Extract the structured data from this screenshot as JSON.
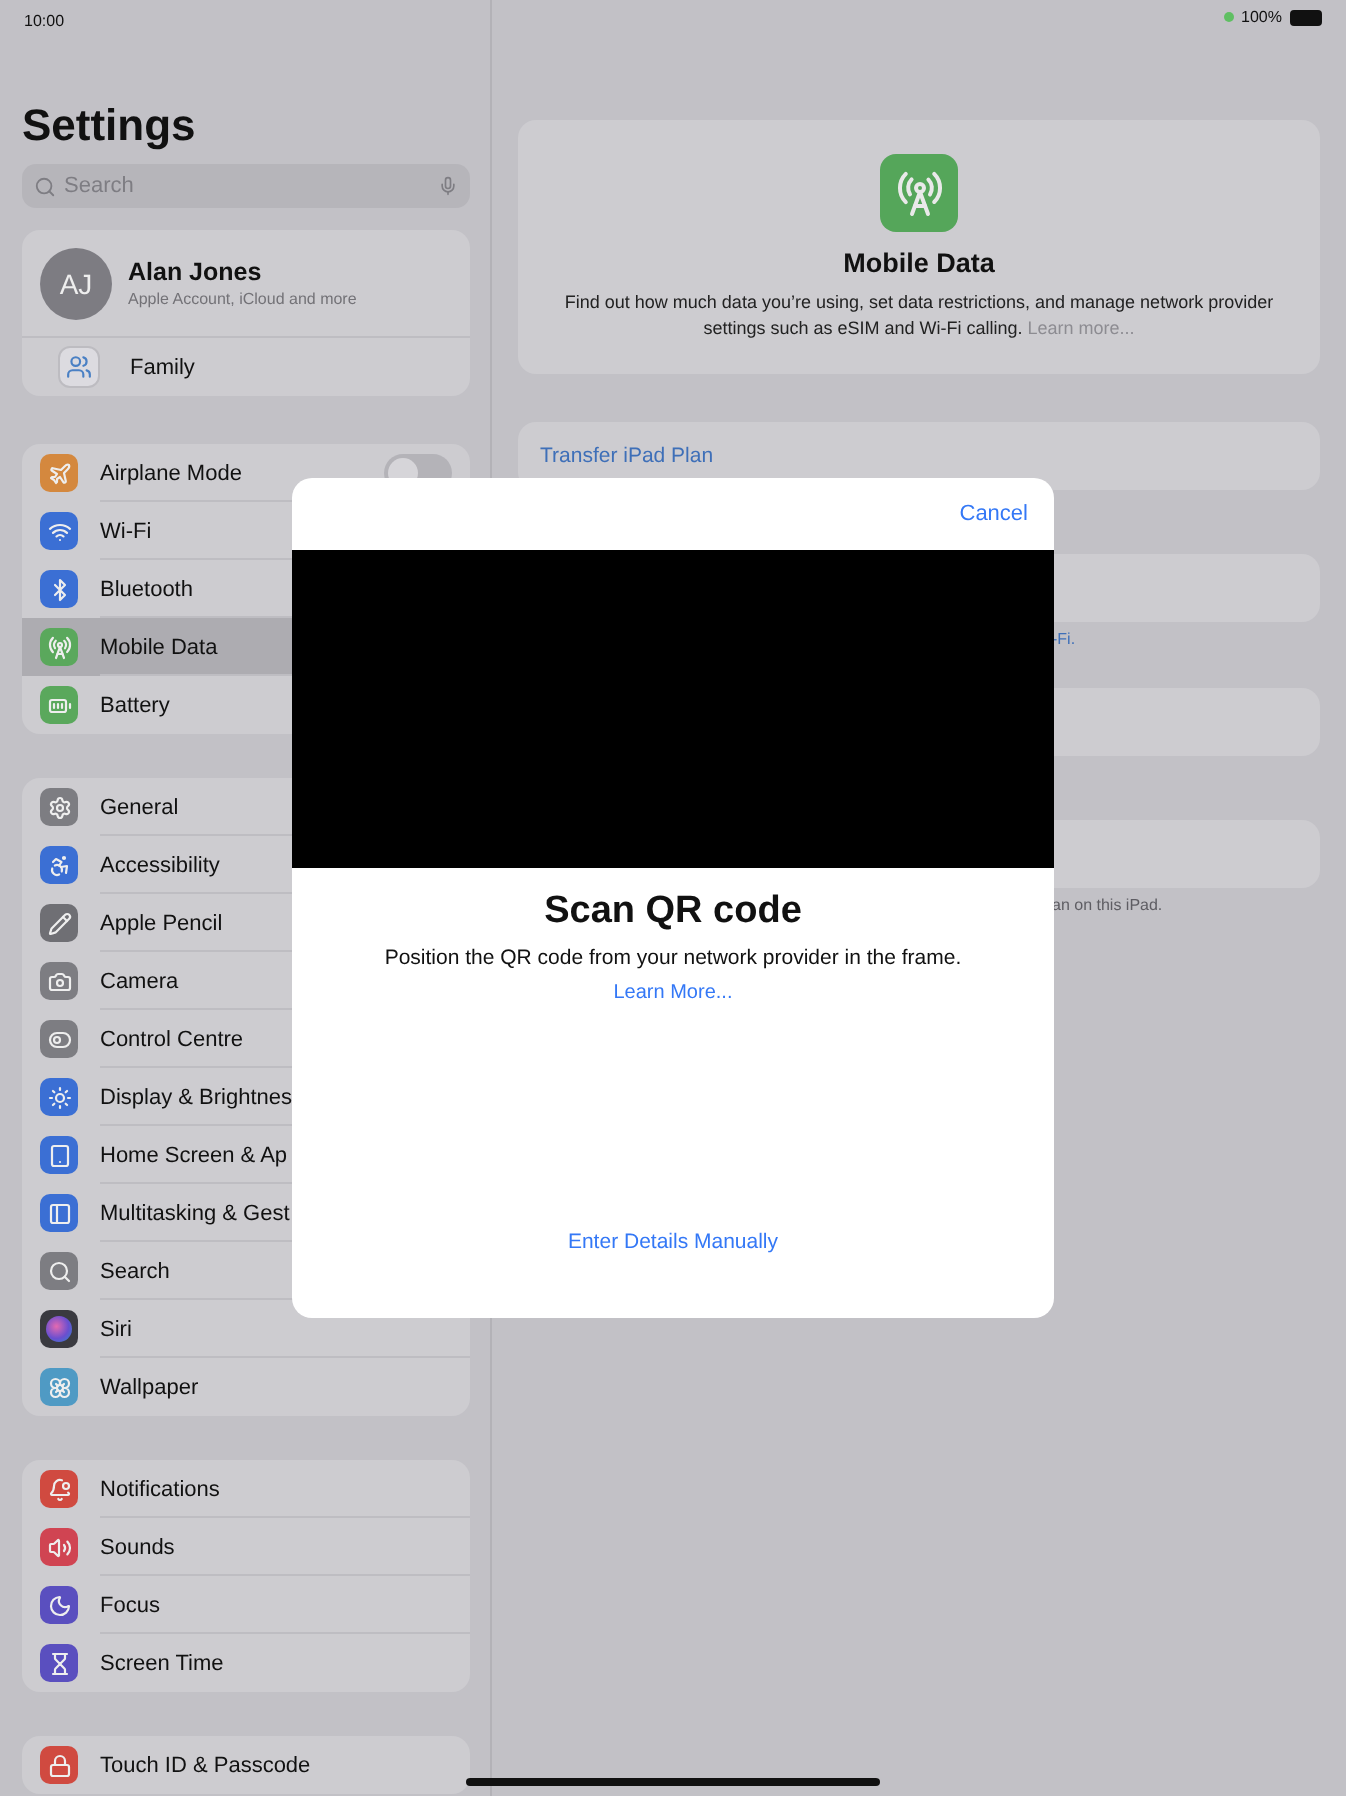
{
  "status_bar": {
    "time": "10:00",
    "battery": "100%"
  },
  "sidebar": {
    "title": "Settings",
    "search": {
      "placeholder": "Search"
    },
    "account": {
      "initials": "AJ",
      "name": "Alan Jones",
      "subtitle": "Apple Account, iCloud and more",
      "family": "Family"
    },
    "groups": [
      [
        {
          "label": "Airplane Mode",
          "color": "#d4883e",
          "kind": "toggle",
          "on": false,
          "selected": false
        },
        {
          "label": "Wi-Fi",
          "color": "#3b6fd4",
          "kind": "link",
          "selected": false
        },
        {
          "label": "Bluetooth",
          "color": "#3b6fd4",
          "kind": "link",
          "selected": false
        },
        {
          "label": "Mobile Data",
          "color": "#5aa85c",
          "kind": "link",
          "selected": true
        },
        {
          "label": "Battery",
          "color": "#5aa85c",
          "kind": "link",
          "selected": false
        }
      ],
      [
        {
          "label": "General",
          "color": "#7d7d82",
          "kind": "link",
          "selected": false
        },
        {
          "label": "Accessibility",
          "color": "#3b6fd4",
          "kind": "link",
          "selected": false
        },
        {
          "label": "Apple Pencil",
          "color": "#6f6f74",
          "kind": "link",
          "selected": false
        },
        {
          "label": "Camera",
          "color": "#7d7d82",
          "kind": "link",
          "selected": false
        },
        {
          "label": "Control Centre",
          "color": "#7d7d82",
          "kind": "link",
          "selected": false
        },
        {
          "label": "Display & Brightnes",
          "color": "#3b6fd4",
          "kind": "link",
          "selected": false
        },
        {
          "label": "Home Screen & Ap",
          "color": "#3b6fd4",
          "kind": "link",
          "selected": false
        },
        {
          "label": "Multitasking & Gest",
          "color": "#3b6fd4",
          "kind": "link",
          "selected": false
        },
        {
          "label": "Search",
          "color": "#7d7d82",
          "kind": "link",
          "selected": false
        },
        {
          "label": "Siri",
          "color": "#3a3a40",
          "kind": "link",
          "selected": false
        },
        {
          "label": "Wallpaper",
          "color": "#4f9ac4",
          "kind": "link",
          "selected": false
        }
      ],
      [
        {
          "label": "Notifications",
          "color": "#d04a40",
          "kind": "link",
          "selected": false
        },
        {
          "label": "Sounds",
          "color": "#d04452",
          "kind": "link",
          "selected": false
        },
        {
          "label": "Focus",
          "color": "#5a4fbf",
          "kind": "link",
          "selected": false
        },
        {
          "label": "Screen Time",
          "color": "#5a4fbf",
          "kind": "link",
          "selected": false
        }
      ],
      [
        {
          "label": "Touch ID & Passcode",
          "color": "#d04a40",
          "kind": "link",
          "selected": false
        }
      ]
    ]
  },
  "detail": {
    "header": {
      "title": "Mobile Data",
      "description": "Find out how much data you’re using, set data restrictions, and manage network provider settings such as eSIM and Wi-Fi calling.",
      "link": "Learn more..."
    },
    "sections": [
      {
        "kind": "action",
        "label": "Transfer iPad Plan"
      },
      {
        "kind": "blank",
        "footer": "-Fi."
      },
      {
        "kind": "blank"
      },
      {
        "kind": "blank",
        "footer": "an on this iPad."
      }
    ]
  },
  "modal": {
    "cancel": "Cancel",
    "title": "Scan QR code",
    "description": "Position the QR code from your network provider in the frame.",
    "learn_more": "Learn More...",
    "manual": "Enter Details Manually"
  }
}
